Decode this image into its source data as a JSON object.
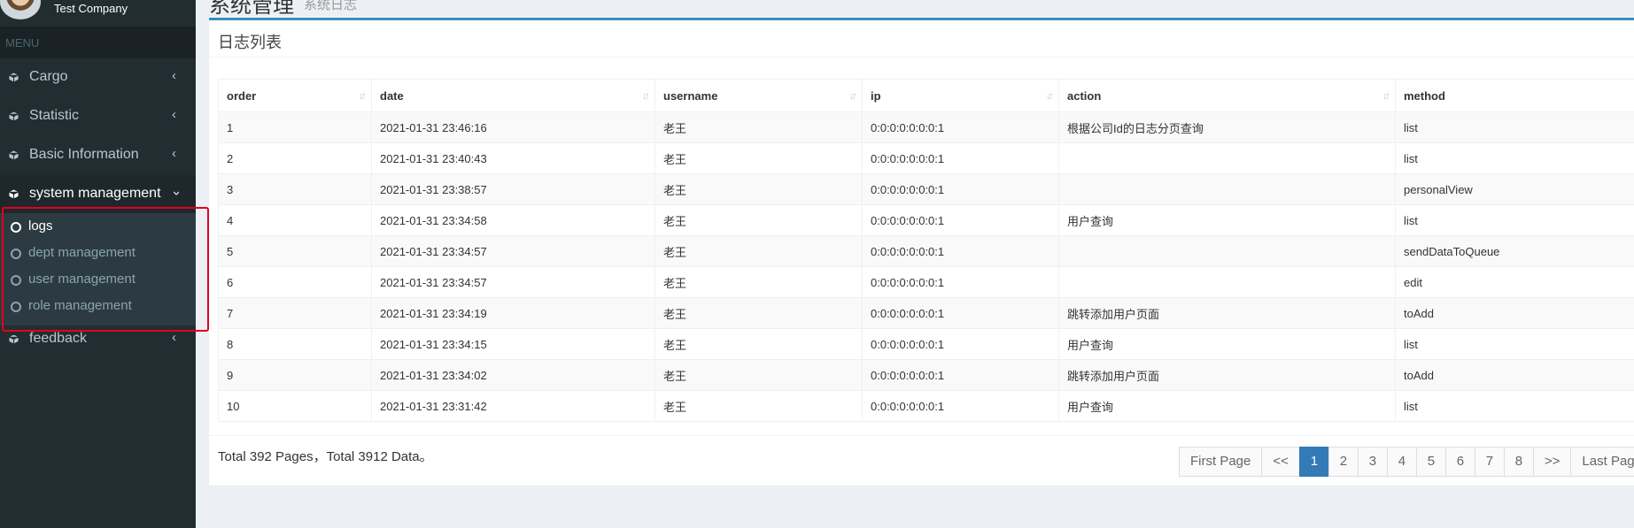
{
  "app": {
    "company": "Test Company",
    "page_title": "系统管理",
    "page_subtitle": "系统日志"
  },
  "sidebar": {
    "menu_header": "MENU",
    "items": [
      {
        "label": "Cargo",
        "icon": "cube-icon"
      },
      {
        "label": "Statistic",
        "icon": "cube-icon"
      },
      {
        "label": "Basic Information",
        "icon": "cube-icon"
      },
      {
        "label": "system management",
        "icon": "cube-icon"
      },
      {
        "label": "feedback",
        "icon": "cube-icon"
      }
    ],
    "submenu": [
      {
        "label": "logs"
      },
      {
        "label": "dept management"
      },
      {
        "label": "user management"
      },
      {
        "label": "role management"
      }
    ]
  },
  "log_list": {
    "title": "日志列表",
    "columns": [
      "order",
      "date",
      "username",
      "ip",
      "action",
      "method"
    ],
    "rows": [
      [
        "1",
        "2021-01-31 23:46:16",
        "老王",
        "0:0:0:0:0:0:0:1",
        "根据公司Id的日志分页查询",
        "list"
      ],
      [
        "2",
        "2021-01-31 23:40:43",
        "老王",
        "0:0:0:0:0:0:0:1",
        "",
        "list"
      ],
      [
        "3",
        "2021-01-31 23:38:57",
        "老王",
        "0:0:0:0:0:0:0:1",
        "",
        "personalView"
      ],
      [
        "4",
        "2021-01-31 23:34:58",
        "老王",
        "0:0:0:0:0:0:0:1",
        "用户查询",
        "list"
      ],
      [
        "5",
        "2021-01-31 23:34:57",
        "老王",
        "0:0:0:0:0:0:0:1",
        "",
        "sendDataToQueue"
      ],
      [
        "6",
        "2021-01-31 23:34:57",
        "老王",
        "0:0:0:0:0:0:0:1",
        "",
        "edit"
      ],
      [
        "7",
        "2021-01-31 23:34:19",
        "老王",
        "0:0:0:0:0:0:0:1",
        "跳转添加用户页面",
        "toAdd"
      ],
      [
        "8",
        "2021-01-31 23:34:15",
        "老王",
        "0:0:0:0:0:0:0:1",
        "用户查询",
        "list"
      ],
      [
        "9",
        "2021-01-31 23:34:02",
        "老王",
        "0:0:0:0:0:0:0:1",
        "跳转添加用户页面",
        "toAdd"
      ],
      [
        "10",
        "2021-01-31 23:31:42",
        "老王",
        "0:0:0:0:0:0:0:1",
        "用户查询",
        "list"
      ]
    ]
  },
  "footer": {
    "total_text": "Total 392 Pages，Total 3912 Data。"
  },
  "pagination": {
    "first": "First Page",
    "prev": "<<",
    "pages": [
      "1",
      "2",
      "3",
      "4",
      "5",
      "6",
      "7",
      "8"
    ],
    "current": "1",
    "next": ">>",
    "last": "Last Page"
  },
  "colors": {
    "sidebar_bg": "#222d32",
    "accent": "#3c8dbc",
    "active_page": "#337ab7",
    "highlight": "#e3001b"
  }
}
